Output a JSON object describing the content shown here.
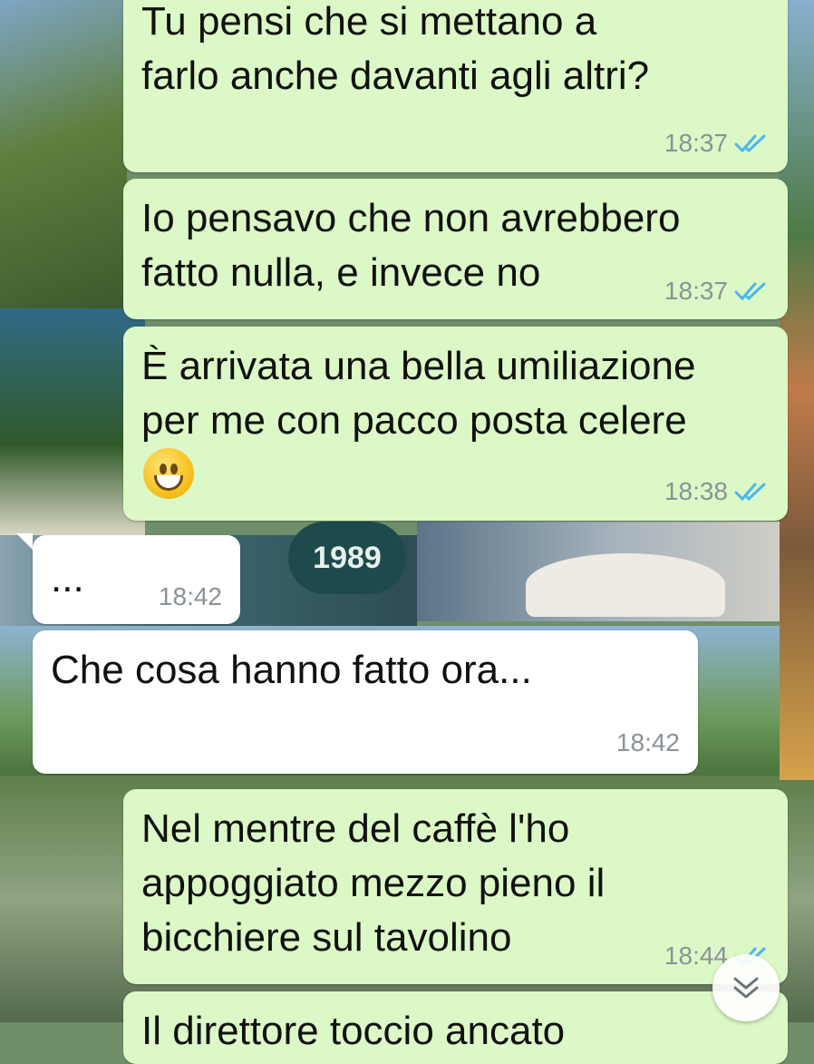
{
  "background": {
    "badge_year": "1989"
  },
  "messages": [
    {
      "direction": "out",
      "text": "Tu pensi che si mettano a\nfarlo anche davanti agli altri?",
      "time": "18:37",
      "status": "read"
    },
    {
      "direction": "out",
      "text": "Io pensavo che non avrebbero\nfatto nulla, e invece no",
      "time": "18:37",
      "status": "read"
    },
    {
      "direction": "out",
      "text": "È arrivata una bella umiliazione\nper me con pacco posta celere",
      "emoji": "grinning-face",
      "time": "18:38",
      "status": "read"
    },
    {
      "direction": "in",
      "text": "...",
      "time": "18:42"
    },
    {
      "direction": "in",
      "text": "Che cosa hanno fatto ora...",
      "time": "18:42"
    },
    {
      "direction": "out",
      "text": "Nel mentre del caffè l'ho\nappoggiato mezzo pieno il\nbicchiere sul tavolino",
      "time": "18:44",
      "status": "read"
    },
    {
      "direction": "out",
      "text": "Il direttore toccio ancato",
      "partial": true
    }
  ],
  "colors": {
    "outgoing": "#dcf8c6",
    "incoming": "#ffffff",
    "read_ticks": "#4fb6ec",
    "meta_text": "#8a9298"
  },
  "icons": {
    "read_receipt": "double-check-icon",
    "scroll_down": "chevron-double-down-icon"
  }
}
